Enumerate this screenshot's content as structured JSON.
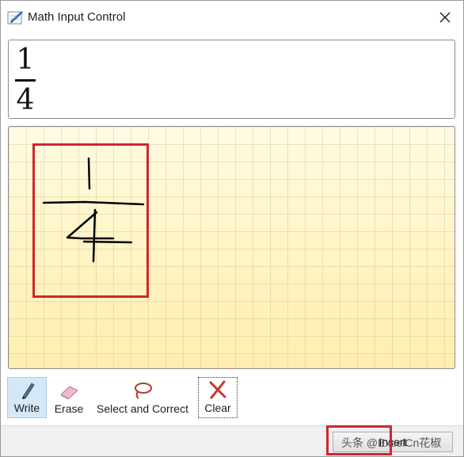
{
  "window": {
    "title": "Math Input Control"
  },
  "preview": {
    "numerator": "1",
    "denominator": "4"
  },
  "toolbar": {
    "write_label": "Write",
    "erase_label": "Erase",
    "select_correct_label": "Select and Correct",
    "clear_label": "Clear"
  },
  "footer": {
    "insert_label": "Insert",
    "watermark": "头条 @ExcelCn花椒"
  },
  "colors": {
    "highlight": "#d0262e",
    "canvas": "#fff5c8",
    "write_active": "#d5e8f7",
    "ink": "#000000"
  }
}
